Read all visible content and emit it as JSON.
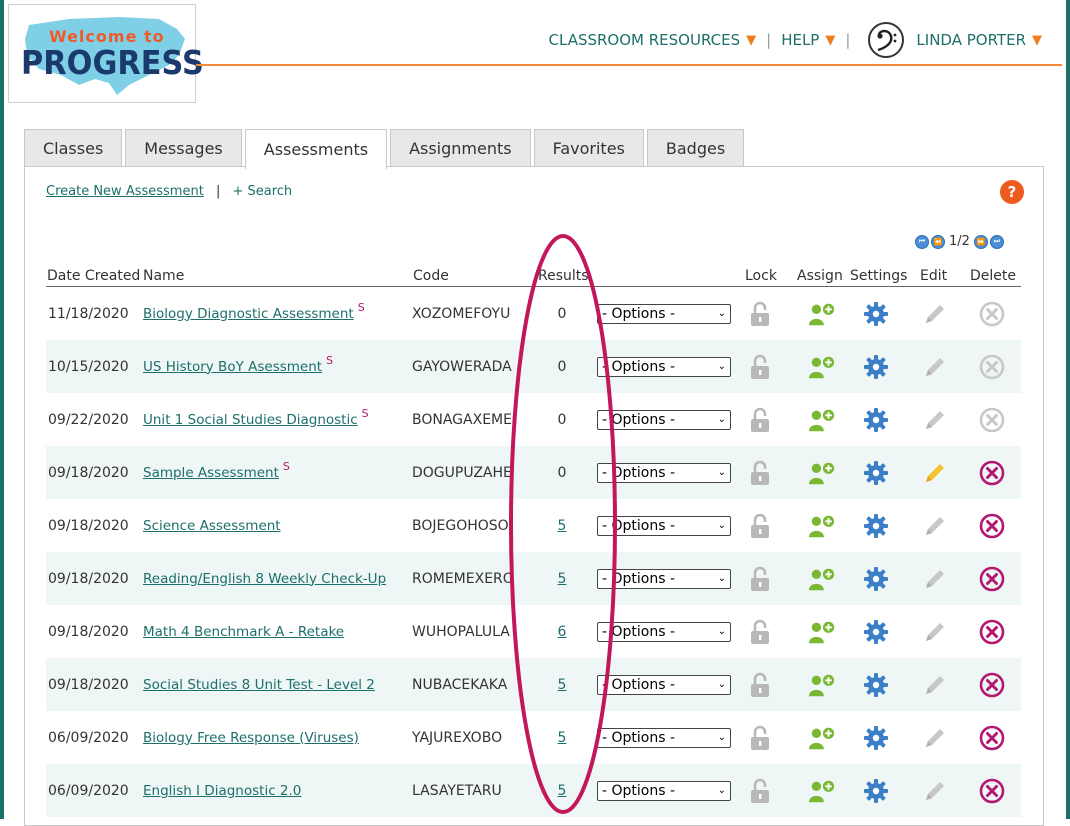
{
  "logo": {
    "welcome": "Welcome to",
    "progress": "PROGRESS"
  },
  "top_nav": {
    "classroom_resources": "CLASSROOM RESOURCES",
    "help": "HELP",
    "user_name": "LINDA PORTER",
    "caret": "▼",
    "separator": "|"
  },
  "tabs": [
    {
      "label": "Classes",
      "active": false
    },
    {
      "label": "Messages",
      "active": false
    },
    {
      "label": "Assessments",
      "active": true
    },
    {
      "label": "Assignments",
      "active": false
    },
    {
      "label": "Favorites",
      "active": false
    },
    {
      "label": "Badges",
      "active": false
    }
  ],
  "toolbar": {
    "create_label": "Create New Assessment",
    "separator": "|",
    "search_label": "+ Search"
  },
  "help_icon": "?",
  "pager": {
    "text": "1/2"
  },
  "columns": {
    "date": "Date Created",
    "name": "Name",
    "code": "Code",
    "results": "Results",
    "lock": "Lock",
    "assign": "Assign",
    "settings": "Settings",
    "edit": "Edit",
    "delete": "Delete"
  },
  "options_label": "- Options -",
  "rows": [
    {
      "date": "11/18/2020",
      "name": "Biology Diagnostic Assessment",
      "sup": "S",
      "code": "XOZOMEFOYU",
      "results": "0",
      "results_link": false,
      "edit_active": false,
      "delete_active": false
    },
    {
      "date": "10/15/2020",
      "name": "US History BoY Asessment",
      "sup": "S",
      "code": "GAYOWERADA",
      "results": "0",
      "results_link": false,
      "edit_active": false,
      "delete_active": false
    },
    {
      "date": "09/22/2020",
      "name": "Unit 1 Social Studies Diagnostic",
      "sup": "S",
      "code": "BONAGAXEME",
      "results": "0",
      "results_link": false,
      "edit_active": false,
      "delete_active": false
    },
    {
      "date": "09/18/2020",
      "name": "Sample Assessment",
      "sup": "S",
      "code": "DOGUPUZAHE",
      "results": "0",
      "results_link": false,
      "edit_active": true,
      "delete_active": true
    },
    {
      "date": "09/18/2020",
      "name": "Science Assessment",
      "sup": "",
      "code": "BOJEGOHOSO",
      "results": "5",
      "results_link": true,
      "edit_active": false,
      "delete_active": true
    },
    {
      "date": "09/18/2020",
      "name": "Reading/English 8 Weekly Check-Up",
      "sup": "",
      "code": "ROMEMEXERO",
      "results": "5",
      "results_link": true,
      "edit_active": false,
      "delete_active": true
    },
    {
      "date": "09/18/2020",
      "name": "Math 4 Benchmark A - Retake",
      "sup": "",
      "code": "WUHOPALULA",
      "results": "6",
      "results_link": true,
      "edit_active": false,
      "delete_active": true
    },
    {
      "date": "09/18/2020",
      "name": "Social Studies 8 Unit Test - Level 2",
      "sup": "",
      "code": "NUBACEKAKA",
      "results": "5",
      "results_link": true,
      "edit_active": false,
      "delete_active": true
    },
    {
      "date": "06/09/2020",
      "name": "Biology Free Response (Viruses)",
      "sup": "",
      "code": "YAJUREXOBO",
      "results": "5",
      "results_link": true,
      "edit_active": false,
      "delete_active": true
    },
    {
      "date": "06/09/2020",
      "name": "English I Diagnostic 2.0",
      "sup": "",
      "code": "LASAYETARU",
      "results": "5",
      "results_link": true,
      "edit_active": false,
      "delete_active": true
    }
  ],
  "colors": {
    "teal": "#1d6f6a",
    "orange": "#f07c1a",
    "magenta": "#b5166e",
    "green": "#7ab834",
    "blue": "#3a7fc8"
  }
}
